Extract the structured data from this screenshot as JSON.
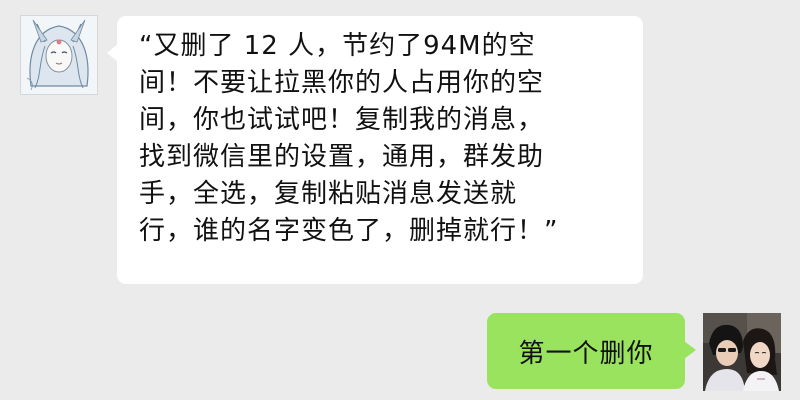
{
  "messages": [
    {
      "direction": "incoming",
      "avatar_icon": "anime-character-avatar-icon",
      "text": "“又删了 12 人，节约了94M的空\n间！不要让拉黑你的人占用你的空\n间，你也试试吧！复制我的消息，\n找到微信里的设置，通用，群发助\n手，全选，复制粘贴消息发送就\n行，谁的名字变色了，删掉就行！”"
    },
    {
      "direction": "outgoing",
      "avatar_icon": "couple-photo-avatar-icon",
      "text": "第一个删你"
    }
  ],
  "colors": {
    "background": "#ebebeb",
    "incoming_bubble": "#ffffff",
    "outgoing_bubble": "#9ae35e"
  }
}
